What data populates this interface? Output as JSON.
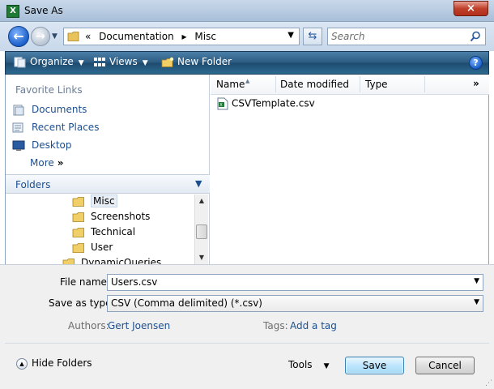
{
  "window": {
    "title": "Save As",
    "app_icon": "excel-icon",
    "close_label": "×"
  },
  "address": {
    "breadcrumbs": [
      "«",
      "Documentation",
      "▸",
      "Misc"
    ],
    "search_placeholder": "Search"
  },
  "toolbar": {
    "organize": "Organize",
    "views": "Views",
    "new_folder": "New Folder",
    "help": "?",
    "bg_color": "#2b5a80"
  },
  "favorites": {
    "header": "Favorite Links",
    "items": [
      {
        "label": "Documents",
        "icon": "documents-icon"
      },
      {
        "label": "Recent Places",
        "icon": "recent-places-icon"
      },
      {
        "label": "Desktop",
        "icon": "desktop-icon"
      },
      {
        "label": "More",
        "icon": "chevron-right-icon"
      }
    ],
    "more_chevron": "»"
  },
  "folders": {
    "header": "Folders",
    "chevron": "⌄",
    "items": [
      {
        "label": "Misc",
        "selected": true
      },
      {
        "label": "Screenshots"
      },
      {
        "label": "Technical"
      },
      {
        "label": "User"
      },
      {
        "label": "DynamicQueries"
      }
    ]
  },
  "filelist": {
    "columns": [
      "Name",
      "Date modified",
      "Type"
    ],
    "more": "»",
    "files": [
      {
        "name": "CSVTemplate.csv",
        "icon": "excel-csv-icon"
      }
    ]
  },
  "form": {
    "file_name_label": "File name:",
    "file_name_value": "Users.csv",
    "save_as_type_label": "Save as type:",
    "save_as_type_value": "CSV (Comma delimited) (*.csv)",
    "authors_label": "Authors:",
    "authors_value": "Gert Joensen",
    "tags_label": "Tags:",
    "tags_value": "Add a tag"
  },
  "footer": {
    "hide_folders": "Hide Folders",
    "tools": "Tools",
    "save": "Save",
    "cancel": "Cancel"
  },
  "colors": {
    "link": "#1c4f8f",
    "accent": "#3c7fb1",
    "title_bar": "#c9d9ea"
  }
}
